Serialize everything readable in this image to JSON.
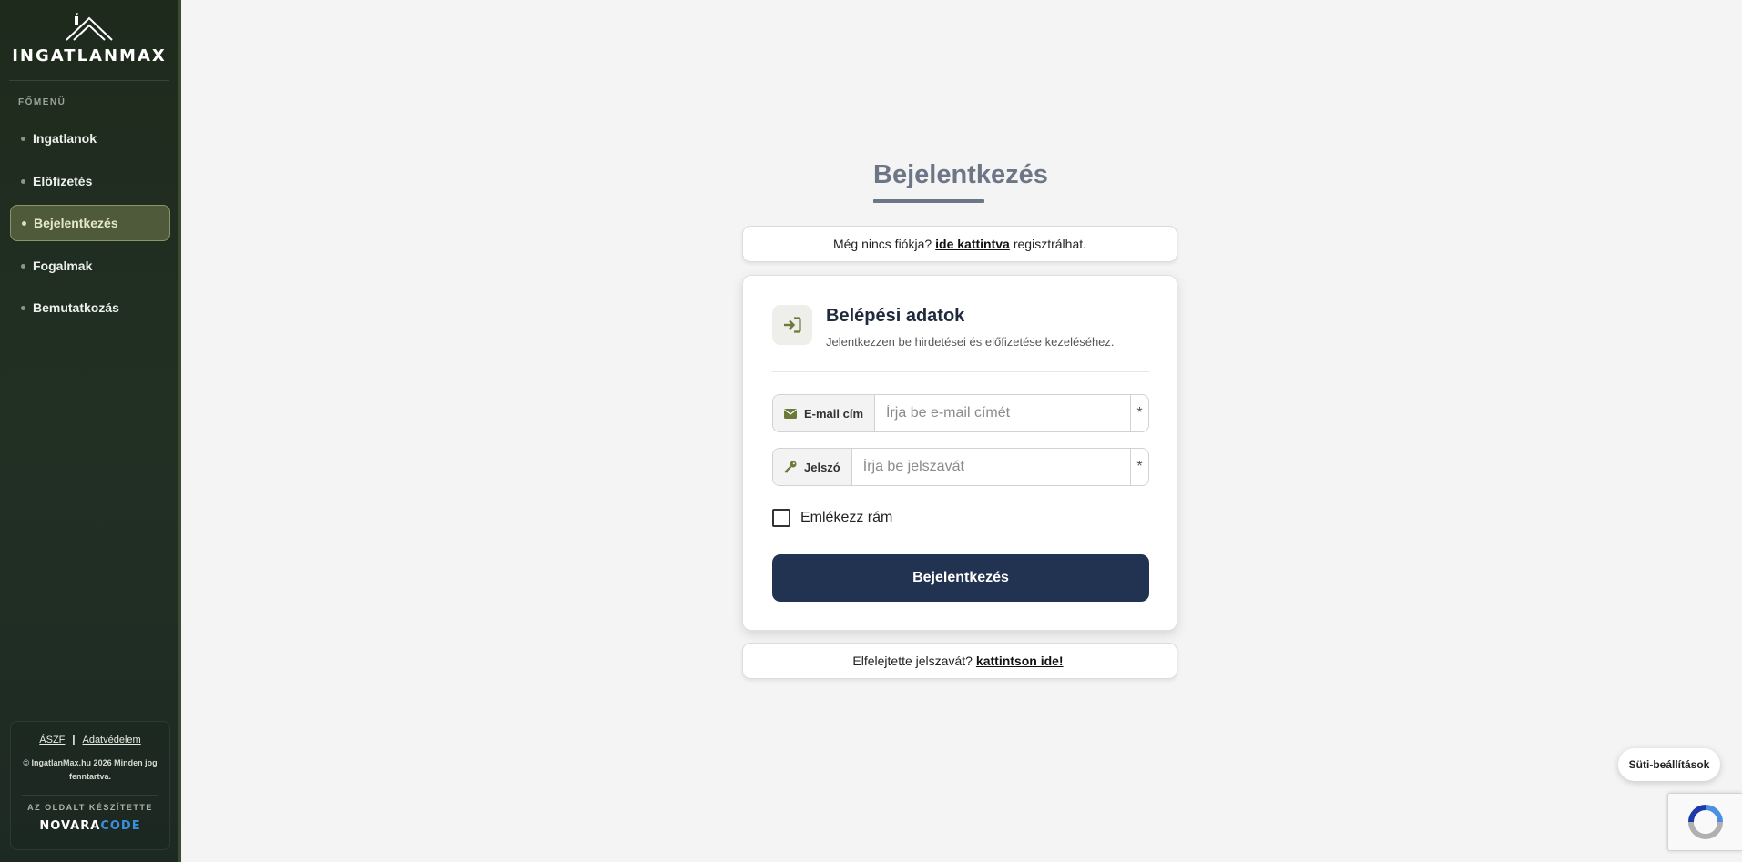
{
  "sidebar": {
    "logo_text": "INGATLANMAX",
    "menu_heading": "FŐMENÜ",
    "items": [
      {
        "label": "Ingatlanok"
      },
      {
        "label": "Előfizetés"
      },
      {
        "label": "Bejelentkezés"
      },
      {
        "label": "Fogalmak"
      },
      {
        "label": "Bemutatkozás"
      }
    ],
    "active_item": "Bejelentkezés",
    "footer": {
      "link_terms": "ÁSZF",
      "separator": "|",
      "link_privacy": "Adatvédelem",
      "copyright": "© IngatlanMax.hu 2026 Minden jog fenntartva.",
      "made_by_label": "AZ OLDALT KÉSZÍTETTE",
      "brand_part1": "NOVARA",
      "brand_part2": "CODE"
    }
  },
  "main": {
    "title": "Bejelentkezés",
    "register_note": {
      "prefix": "Még nincs fiókja?",
      "link": "ide kattintva",
      "suffix": "regisztrálhat."
    },
    "login_card": {
      "header_title": "Belépési adatok",
      "header_subtitle": "Jelentkezzen be hirdetései és előfizetése kezeléséhez.",
      "email_label": "E-mail cím",
      "email_placeholder": "Írja be e-mail címét",
      "email_value": "",
      "password_label": "Jelszó",
      "password_placeholder": "Írja be jelszavát",
      "password_value": "",
      "required_marker": "*",
      "remember_label": "Emlékezz rám",
      "remember_checked": false,
      "submit_label": "Bejelentkezés"
    },
    "forgot_note": {
      "prefix": "Elfelejtette jelszavát?",
      "link": "kattintson ide!"
    }
  },
  "cookie_settings_label": "Süti-beállítások",
  "colors": {
    "sidebar_bg": "#1e2a1c",
    "accent_olive": "#6b7a3a",
    "primary_button": "#213350",
    "title_gray": "#6d7686",
    "brand_blue": "#3b8ed8"
  },
  "icons": {
    "logo": "house-roof-icon",
    "header": "sign-in-icon",
    "email": "envelope-icon",
    "password": "key-icon",
    "recaptcha": "recaptcha-icon"
  }
}
